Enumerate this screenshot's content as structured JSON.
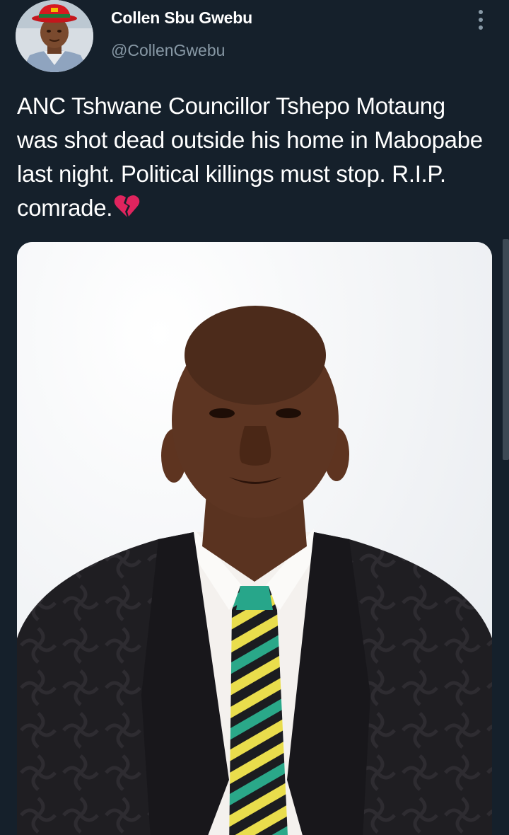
{
  "author": {
    "display_name": "Collen Sbu Gwebu",
    "handle": "@CollenGwebu",
    "avatar_icon": "profile-photo-man-red-hat"
  },
  "tweet": {
    "text": "ANC Tshwane Councillor Tshepo Motaung was shot dead outside his home in Mabopabe last night. Political killings must stop. R.I.P. comrade.",
    "emoji_icon": "broken-heart-icon"
  },
  "media": {
    "image_icon": "portrait-photo-man-suit-striped-tie"
  },
  "colors": {
    "background": "#15202b",
    "text_primary": "#ffffff",
    "text_secondary": "#8899a6",
    "broken_heart": "#e0245e"
  }
}
